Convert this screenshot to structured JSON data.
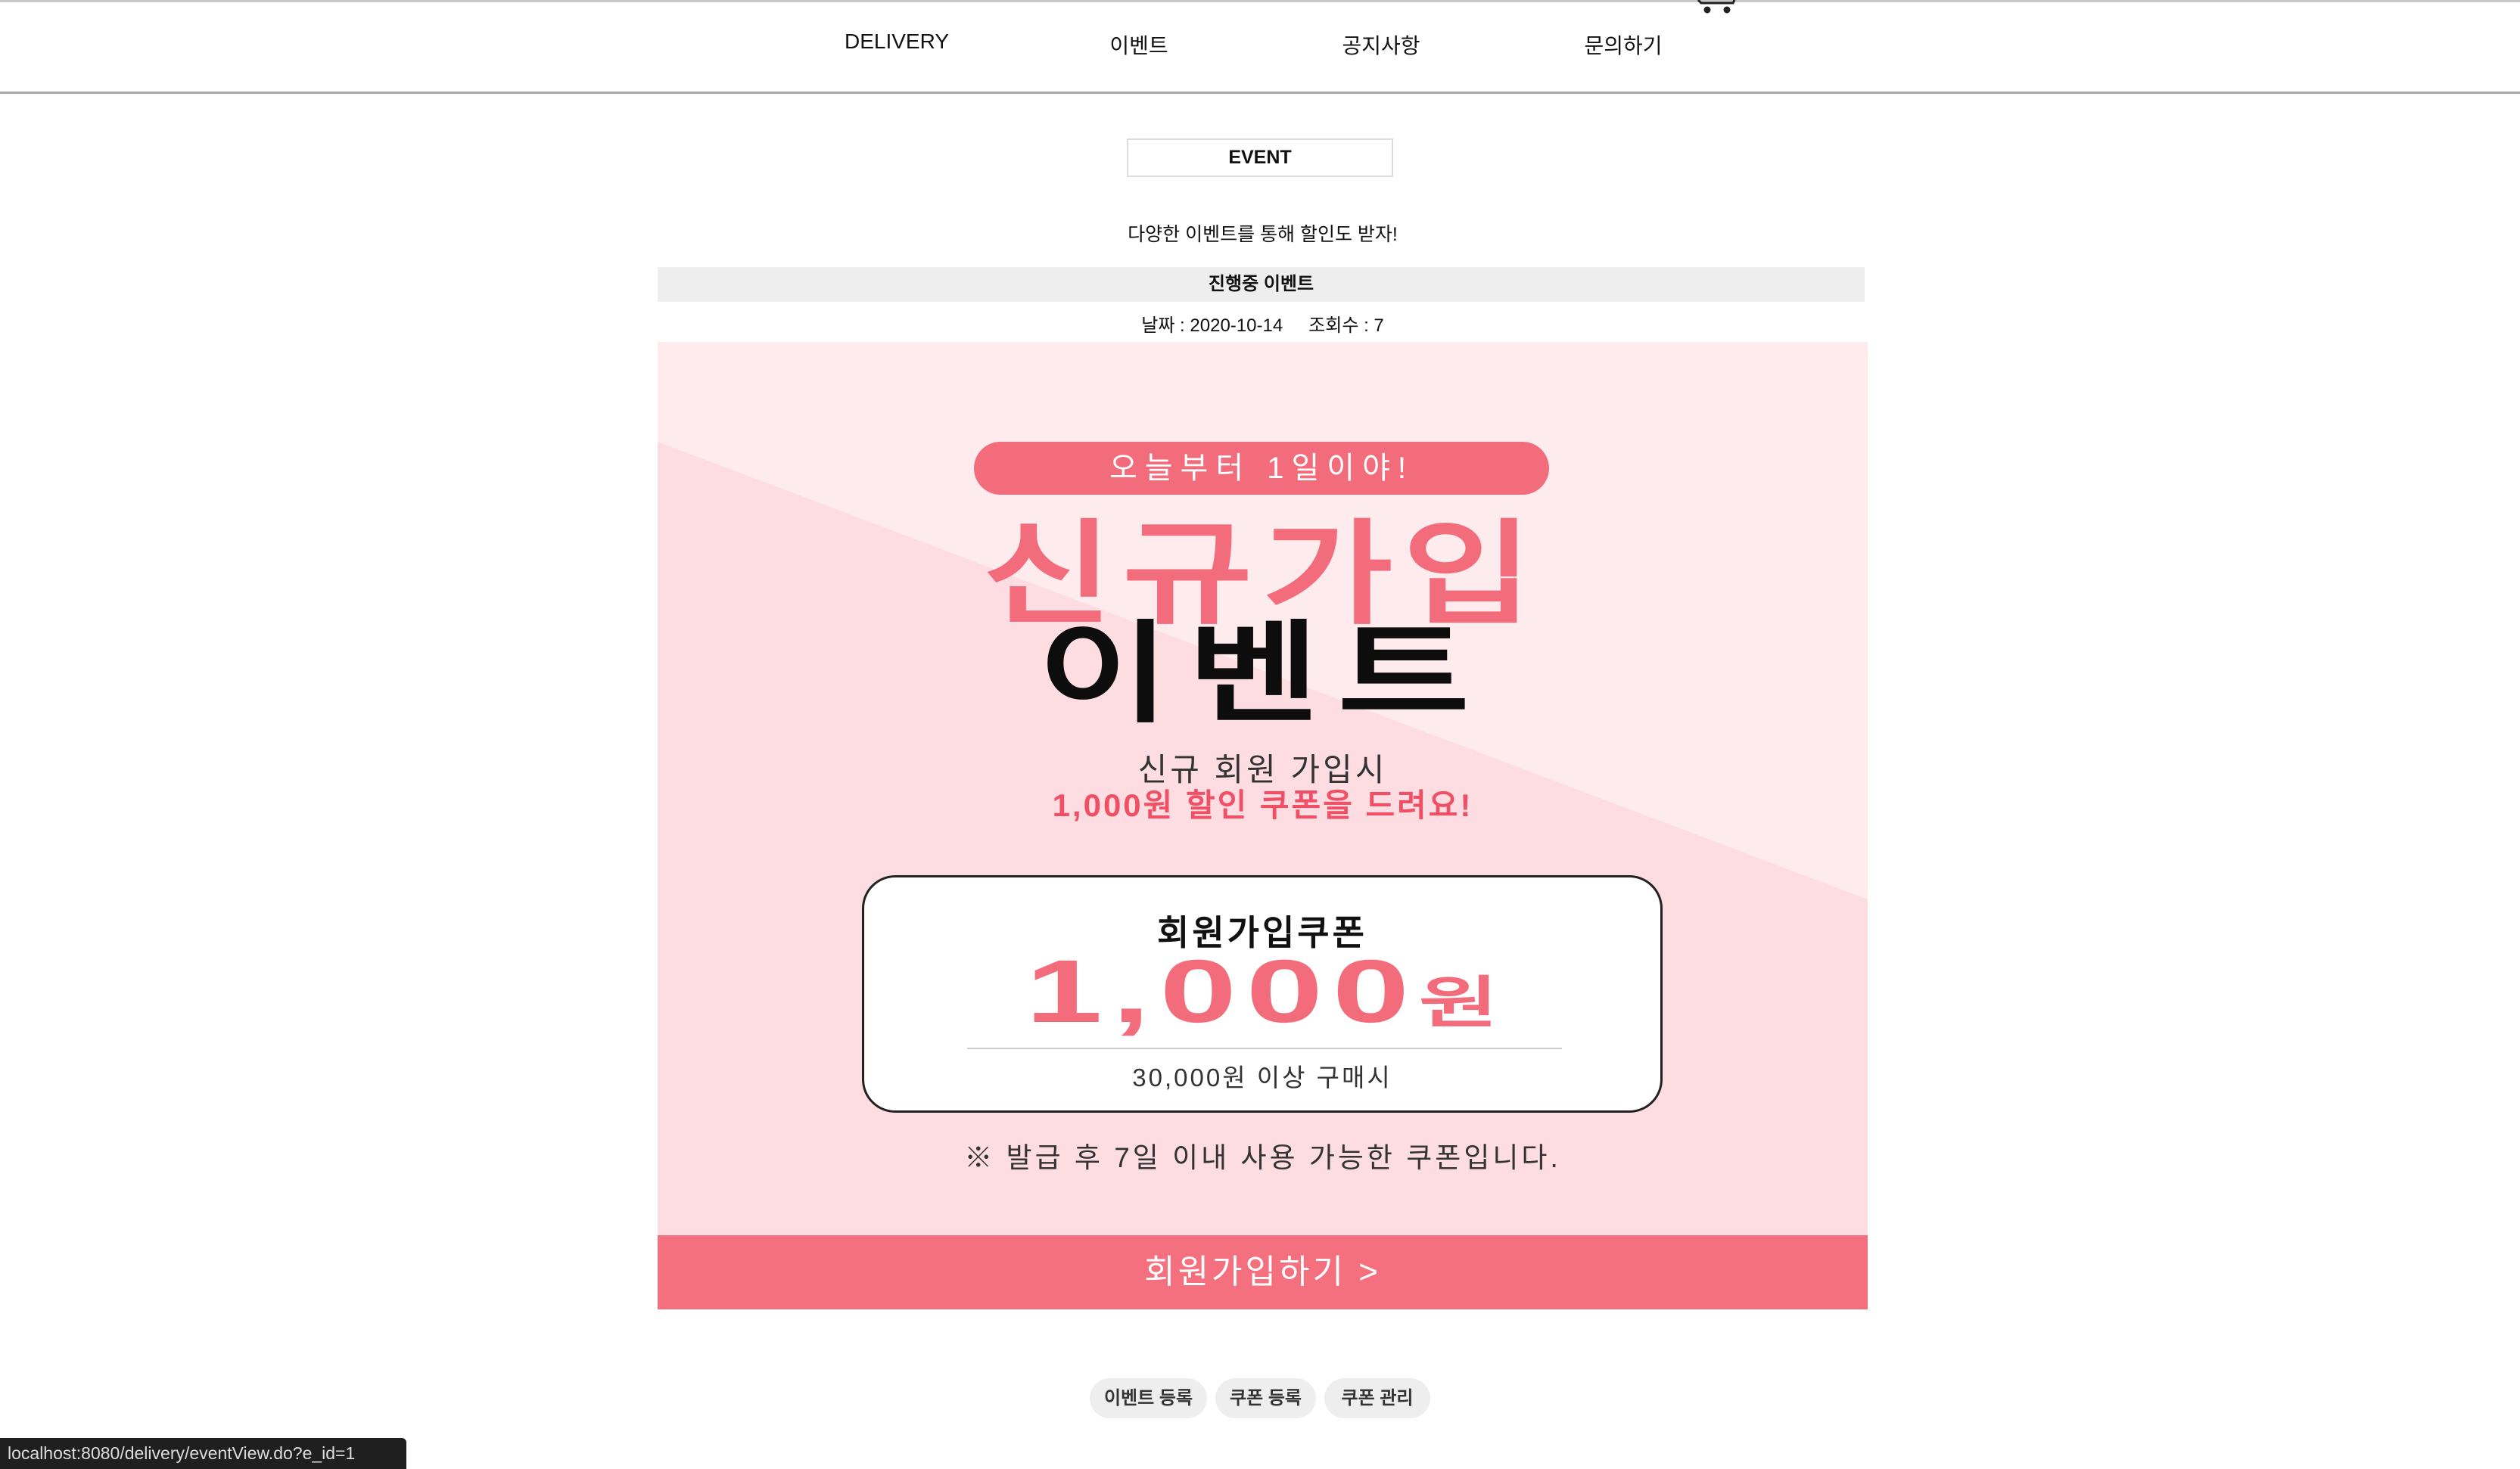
{
  "nav": {
    "items": [
      "DELIVERY",
      "이벤트",
      "공지사항",
      "문의하기"
    ],
    "cart_icon": "cart-icon"
  },
  "header": {
    "title": "EVENT",
    "subtitle": "다양한 이벤트를 통해 할인도 받자!"
  },
  "event": {
    "status": "진행중 이벤트",
    "date": "날짜 : 2020-10-14",
    "views": "조회수 : 7",
    "banner": {
      "pill": "오늘부터 1일이야!",
      "title_line1": "신규가입",
      "title_line2": "이벤트",
      "desc_line1": "신규 회원 가입시",
      "desc_line2": "1,000원 할인 쿠폰을 드려요!",
      "coupon": {
        "label": "회원가입쿠폰",
        "amount": "1,000",
        "unit": "원",
        "condition": "30,000원 이상 구매시"
      },
      "note": "※ 발급 후 7일 이내 사용 가능한 쿠폰입니다.",
      "cta": "회원가입하기 >"
    }
  },
  "admin_buttons": [
    "이벤트 등록",
    "쿠폰 등록",
    "쿠폰 관리"
  ],
  "status_bar": {
    "url": "localhost:8080/delivery/eventView.do?e_id=1"
  },
  "colors": {
    "accent": "#f26c7b",
    "cta": "#f5707f",
    "banner_light": "#fdebee",
    "banner_base": "#fddde2"
  }
}
